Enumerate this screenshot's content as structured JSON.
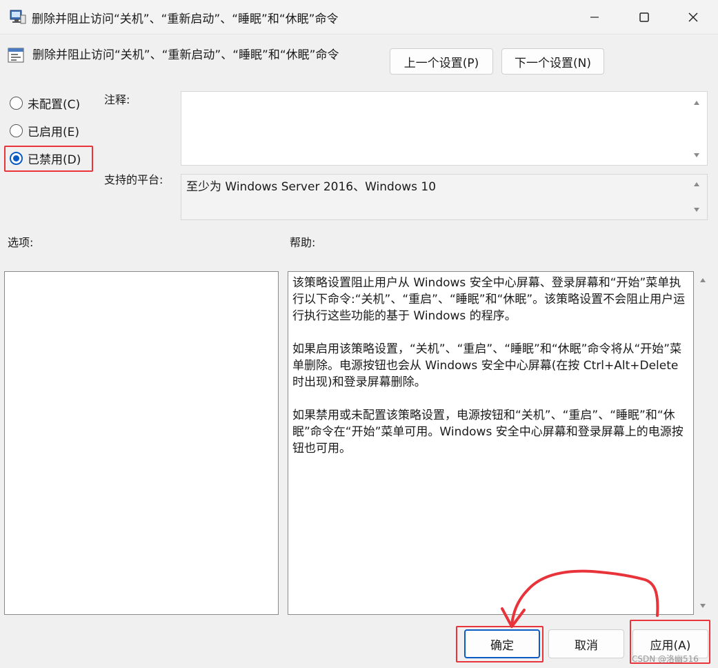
{
  "window": {
    "title": "删除并阻止访问“关机”、“重新启动”、“睡眠”和“休眠”命令",
    "controls": {
      "minimize": "minimize",
      "maximize": "maximize",
      "close": "close"
    }
  },
  "header": {
    "policy_name": "删除并阻止访问“关机”、“重新启动”、“睡眠”和“休眠”命令",
    "prev_label": "上一个设置(P)",
    "next_label": "下一个设置(N)"
  },
  "state": {
    "options": [
      {
        "label": "未配置(C)",
        "selected": false
      },
      {
        "label": "已启用(E)",
        "selected": false
      },
      {
        "label": "已禁用(D)",
        "selected": true
      }
    ]
  },
  "comment": {
    "label": "注释:",
    "value": ""
  },
  "platform": {
    "label": "支持的平台:",
    "value": "至少为 Windows Server 2016、Windows 10"
  },
  "sections": {
    "options_label": "选项:",
    "help_label": "帮助:"
  },
  "help": {
    "paragraphs": [
      "该策略设置阻止用户从 Windows 安全中心屏幕、登录屏幕和“开始”菜单执行以下命令:“关机”、“重启”、“睡眠”和“休眠”。该策略设置不会阻止用户运行执行这些功能的基于 Windows 的程序。",
      "如果启用该策略设置，“关机”、“重启”、“睡眠”和“休眠”命令将从“开始”菜单删除。电源按钮也会从 Windows 安全中心屏幕(在按 Ctrl+Alt+Delete 时出现)和登录屏幕删除。",
      "如果禁用或未配置该策略设置，电源按钮和“关机”、“重启”、“睡眠”和“休眠”命令在“开始”菜单可用。Windows 安全中心屏幕和登录屏幕上的电源按钮也可用。"
    ]
  },
  "footer": {
    "ok_label": "确定",
    "cancel_label": "取消",
    "apply_label": "应用(A)"
  },
  "watermark": "CSDN @洛幽516",
  "colors": {
    "accent": "#0a5bc4",
    "annotation": "#e8333a"
  }
}
